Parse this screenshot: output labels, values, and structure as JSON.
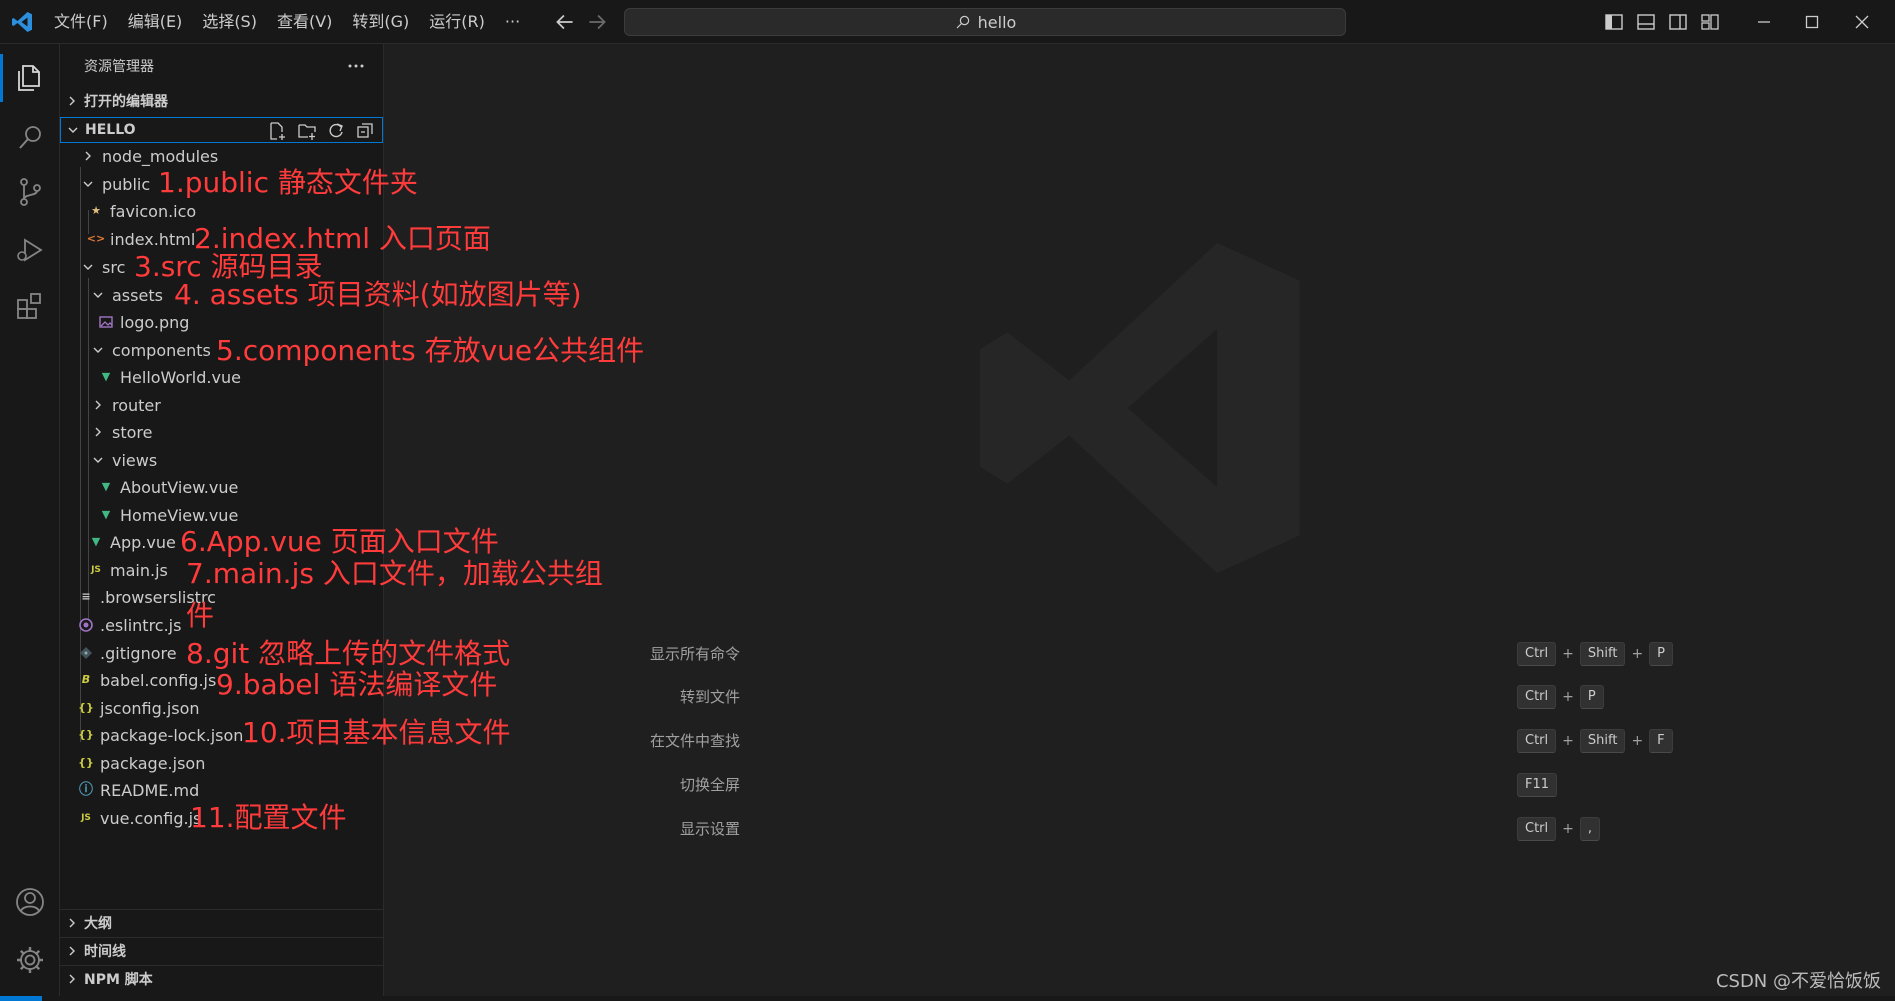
{
  "titlebar": {
    "menu": [
      "文件(F)",
      "编辑(E)",
      "选择(S)",
      "查看(V)",
      "转到(G)",
      "运行(R)",
      "···"
    ],
    "search_text": "hello"
  },
  "activity_bar": {
    "icons": [
      "explorer-icon",
      "search-icon",
      "source-control-icon",
      "run-debug-icon",
      "extensions-icon",
      "account-icon",
      "settings-gear-icon"
    ]
  },
  "sidebar": {
    "title": "资源管理器",
    "open_editors": "打开的编辑器",
    "project": "HELLO",
    "tree": {
      "node_modules": "node_modules",
      "public": "public",
      "favicon": "favicon.ico",
      "index_html": "index.html",
      "src": "src",
      "assets": "assets",
      "logo": "logo.png",
      "components": "components",
      "helloworld": "HelloWorld.vue",
      "router": "router",
      "store": "store",
      "views": "views",
      "aboutview": "AboutView.vue",
      "homeview": "HomeView.vue",
      "app_vue": "App.vue",
      "main_js": "main.js",
      "browserslistrc": ".browserslistrc",
      "eslintrc": ".eslintrc.js",
      "gitignore": ".gitignore",
      "babel_config": "babel.config.js",
      "jsconfig": "jsconfig.json",
      "package_lock": "package-lock.json",
      "package_json": "package.json",
      "readme": "README.md",
      "vue_config": "vue.config.js"
    },
    "file_icon_glyphs": {
      "html": "<>",
      "js": "JS",
      "json": "{}",
      "readme": "ⓘ",
      "browserslist": "≡",
      "babel": "B",
      "vue": "▼",
      "star": "★"
    },
    "panels": [
      "大纲",
      "时间线",
      "NPM 脚本"
    ]
  },
  "annotations": {
    "a1": "1.public 静态文件夹",
    "a2": "2.index.html 入口页面",
    "a3": "3.src 源码目录",
    "a4": "4. assets 项目资料(如放图片等)",
    "a5": "5.components 存放vue公共组件",
    "a6": "6.App.vue 页面入口文件",
    "a7_line1": "7.main.js  入口文件，加载公共组",
    "a7_line2": "件",
    "a8": "8.git 忽略上传的文件格式",
    "a9": "9.babel 语法编译文件",
    "a10": "10.项目基本信息文件",
    "a11": "11.配置文件"
  },
  "shortcuts": [
    {
      "label": "显示所有命令",
      "keys": [
        "Ctrl",
        "Shift",
        "P"
      ]
    },
    {
      "label": "转到文件",
      "keys": [
        "Ctrl",
        "P"
      ]
    },
    {
      "label": "在文件中查找",
      "keys": [
        "Ctrl",
        "Shift",
        "F"
      ]
    },
    {
      "label": "切换全屏",
      "keys": [
        "F11"
      ]
    },
    {
      "label": "显示设置",
      "keys": [
        "Ctrl",
        ","
      ]
    }
  ],
  "watermark_text": "CSDN @不爱恰饭饭",
  "colors": {
    "accent": "#0078d4",
    "annotation": "#ff3b3b",
    "vue": "#41b883",
    "js": "#cbcb41",
    "json": "#cbcb41",
    "html": "#e37933",
    "readme": "#519aba",
    "eslint": "#a074c4"
  }
}
